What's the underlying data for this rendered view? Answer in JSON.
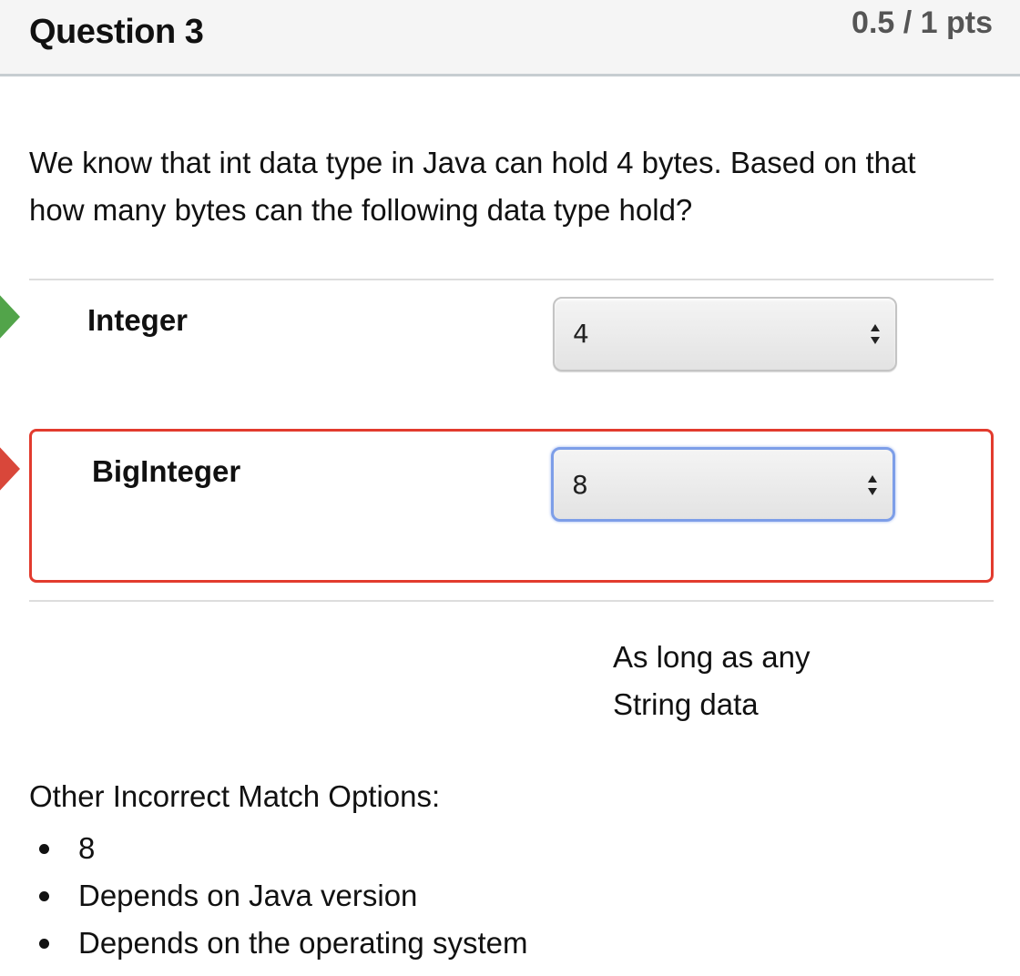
{
  "header": {
    "title": "Question 3",
    "points": "0.5 / 1 pts"
  },
  "question": {
    "text_line1": "We know that int data type in Java can hold 4 bytes. Based on that",
    "text_line2": "how many bytes can the following data type hold?"
  },
  "matches": [
    {
      "label": "Integer",
      "selected": "4",
      "status": "correct"
    },
    {
      "label": "BigInteger",
      "selected": "8",
      "status": "incorrect"
    }
  ],
  "correct_answer": {
    "line1": "As long as any",
    "line2": "String data"
  },
  "other_options": {
    "title": "Other Incorrect Match Options:",
    "items": [
      "8",
      "Depends on Java version",
      "Depends on the operating system"
    ]
  },
  "colors": {
    "correct": "#52a44a",
    "incorrect": "#e23b2e",
    "focus": "#7d9ee8"
  }
}
